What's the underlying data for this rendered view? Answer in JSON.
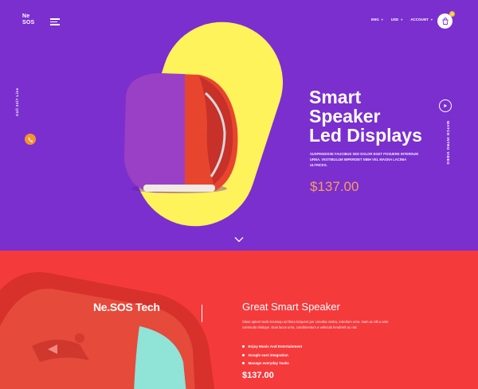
{
  "header": {
    "logo_line1": "Ne",
    "logo_line2": "SOS",
    "nav": [
      "ENG",
      "USD",
      "ACCOUNT"
    ],
    "cart_count": "0"
  },
  "hero": {
    "call_text": "Call 24/7 Line",
    "title_lines": [
      "Smart",
      "Speaker",
      "Led Displays"
    ],
    "description": "SUSPENDISSE FAUCIBUS SED DOLOR EGET POSUERE INTERDUM URNA. VESTIBULUM IMPERDIET NIBH VEL MAGNA LACINIA ULTRICES.",
    "price": "$137.00",
    "watch_text": "WATCH INTRO VIDEO"
  },
  "section2": {
    "brand": "Ne.SOS Tech",
    "title": "Great Smart Speaker",
    "description": "Class aptent taciti sociosqu ad litora torquent per conubia nostra, interdum urna. Nam ac elit a ante commodo tristique. Duis lacus urna, condimentum a vehicula hendrerit ac nisi",
    "features": [
      "Enjoy Music And Entertainment",
      "Google east integration",
      "Manage everyday Tasks"
    ],
    "price": "$137.00"
  },
  "colors": {
    "hero_bg": "#7b2fcf",
    "pill": "#fff35b",
    "speaker": "#e8452f",
    "accent_orange": "#f5932d",
    "section2_bg": "#f53a3c"
  }
}
